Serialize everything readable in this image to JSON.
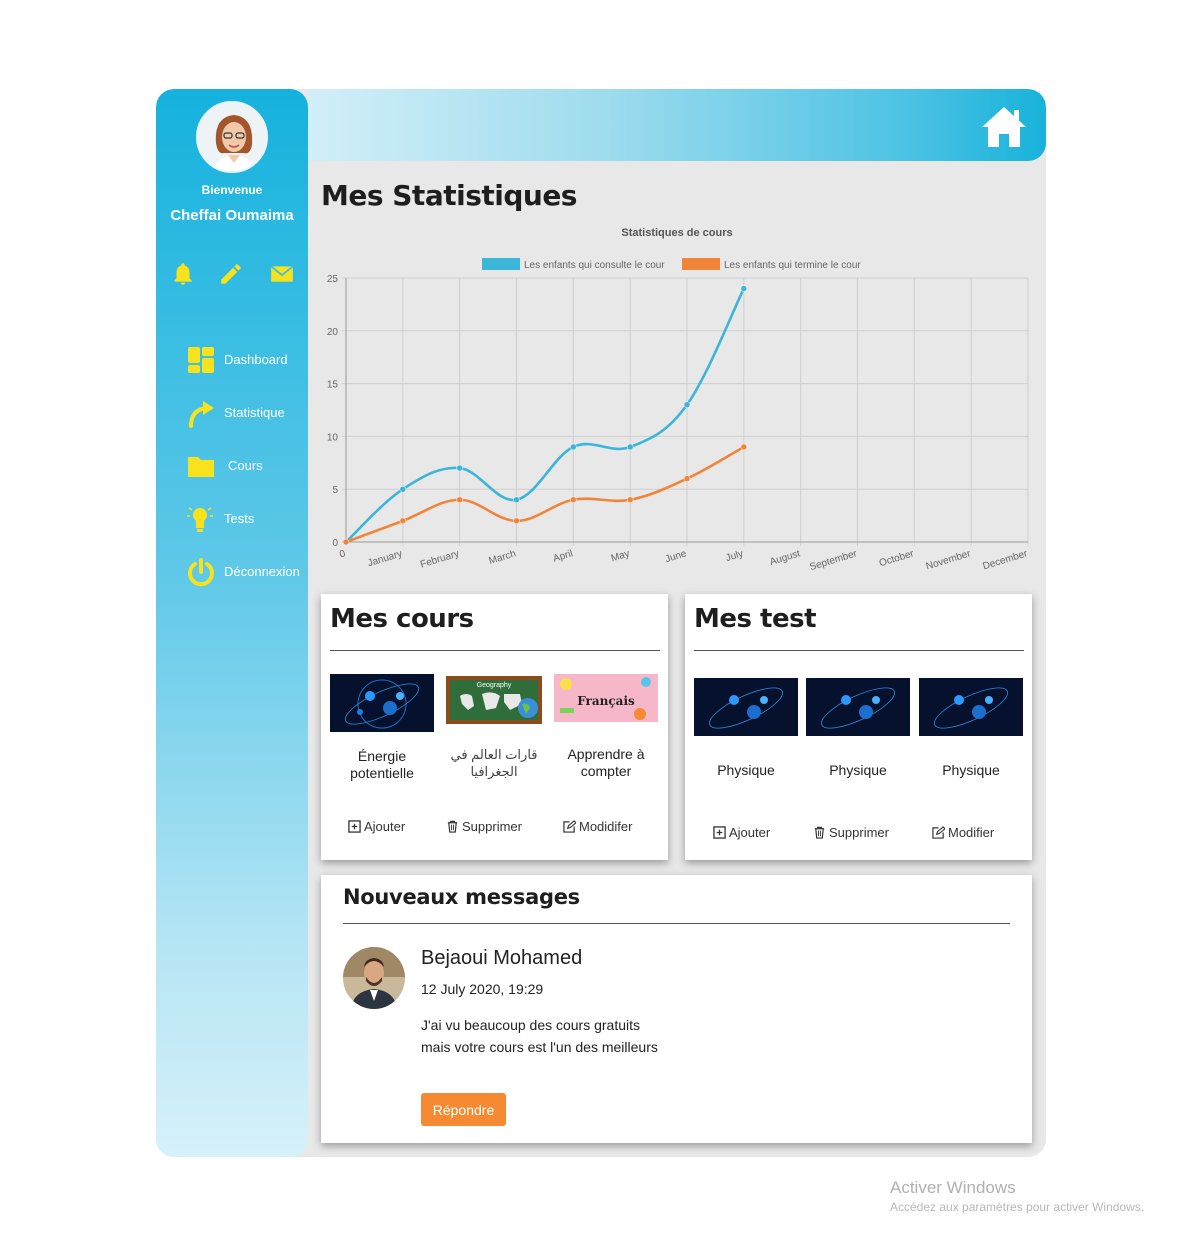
{
  "user": {
    "welcome": "Bienvenue",
    "name": "Cheffai Oumaima"
  },
  "quick_icons": [
    "bell-icon",
    "pencil-icon",
    "mail-icon"
  ],
  "nav": {
    "items": [
      {
        "label": "Dashboard",
        "icon": "grid-icon"
      },
      {
        "label": "Statistique",
        "icon": "arrow-icon"
      },
      {
        "label": "Cours",
        "icon": "folder-icon"
      },
      {
        "label": "Tests",
        "icon": "bulb-icon"
      },
      {
        "label": "Déconnexion",
        "icon": "power-icon"
      }
    ]
  },
  "header": {
    "home_icon": "home-icon"
  },
  "colors": {
    "sidebar_top": "#14b2dd",
    "accent_yellow": "#f8e21c",
    "series_blue": "#3bb5d8",
    "series_orange": "#f0853a",
    "reply_button": "#f58a32"
  },
  "stats": {
    "title": "Mes Statistiques"
  },
  "chart_data": {
    "type": "line",
    "title": "Statistiques de cours",
    "x": [
      "0",
      "January",
      "February",
      "March",
      "April",
      "May",
      "June",
      "July",
      "August",
      "September",
      "October",
      "November",
      "December"
    ],
    "y_ticks": [
      "0",
      "5",
      "10",
      "15",
      "20",
      "25"
    ],
    "ylim": [
      0,
      25
    ],
    "grid": true,
    "legend_position": "top",
    "series": [
      {
        "name": "Les enfants qui consulte le cour",
        "color": "#3bb5d8",
        "values": [
          0,
          5,
          7,
          4,
          9,
          9,
          13,
          24
        ]
      },
      {
        "name": "Les enfants qui termine le cour",
        "color": "#f0853a",
        "values": [
          0,
          2,
          4,
          2,
          4,
          4,
          6,
          9
        ]
      }
    ]
  },
  "courses": {
    "title": "Mes cours",
    "items": [
      {
        "label": "Énergie potentielle",
        "thumb": "molecule"
      },
      {
        "label": "قارات العالم في الجغرافيا",
        "thumb": "geography"
      },
      {
        "label": "Apprendre à compter",
        "thumb": "francais"
      }
    ],
    "thumb_text": {
      "geography": "Geography",
      "francais": "Français"
    },
    "actions": {
      "add": "Ajouter",
      "delete": "Supprimer",
      "edit": "Modidifer"
    }
  },
  "tests": {
    "title": "Mes test",
    "items": [
      {
        "label": "Physique"
      },
      {
        "label": "Physique"
      },
      {
        "label": "Physique"
      }
    ],
    "actions": {
      "add": "Ajouter",
      "delete": "Supprimer",
      "edit": "Modifier"
    }
  },
  "messages": {
    "title": "Nouveaux messages",
    "sender": "Bejaoui Mohamed",
    "date": "12 July 2020, 19:29",
    "body": "J'ai vu beaucoup des cours gratuits mais votre cours est l'un des meilleurs",
    "reply_label": "Répondre"
  },
  "watermark": {
    "line1": "Activer Windows",
    "line2": "Accédez aux paramètres pour activer Windows."
  }
}
